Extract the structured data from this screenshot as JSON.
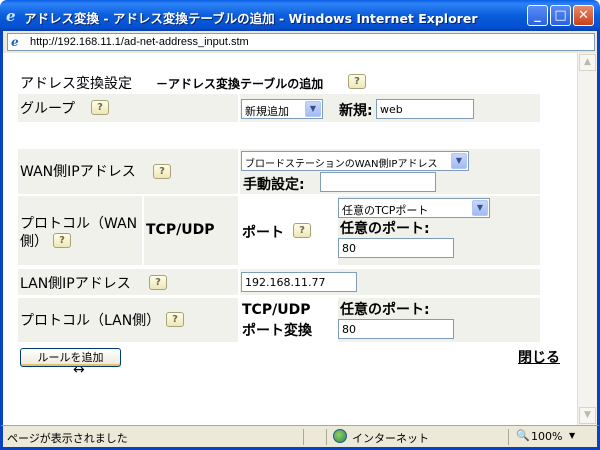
{
  "window": {
    "title": "アドレス変換 - アドレス変換テーブルの追加 - Windows Internet Explorer",
    "minimize": "_",
    "maximize": "□",
    "close": "✕"
  },
  "address_bar": {
    "url": "http://192.168.11.1/ad-net-address_input.stm"
  },
  "page": {
    "heading": "アドレス変換設定",
    "subheading": "－アドレス変換テーブルの追加",
    "group": {
      "label": "グループ",
      "select_value": "新規追加",
      "new_label": "新規:",
      "new_value": "web"
    },
    "wan": {
      "label": "WAN側IPアドレス",
      "select_value": "ブロードステーションのWAN側IPアドレス",
      "manual_label": "手動設定:",
      "manual_value": ""
    },
    "protocol_wan": {
      "label_line1": "プロトコル（WAN",
      "label_line2": "側）",
      "protocol": "TCP/UDP",
      "port_label": "ポート",
      "port_select": "任意のTCPポート",
      "any_port_label": "任意のポート:",
      "port_value": "80"
    },
    "lan": {
      "label": "LAN側IPアドレス",
      "value": "192.168.11.77"
    },
    "protocol_lan": {
      "label": "プロトコル（LAN側）",
      "conv_line1": "TCP/UDP",
      "conv_line2": "ポート変換",
      "any_port_label": "任意のポート:",
      "port_value": "80"
    },
    "add_rule_button": "ルールを追加",
    "close_link": "閉じる",
    "help_icon_glyph": "?"
  },
  "status_bar": {
    "text": "ページが表示されました",
    "zone": "インターネット",
    "zoom": "100%"
  },
  "icons": {
    "help": "help-icon",
    "ie": "ie-icon",
    "globe": "globe-icon",
    "zoom": "zoom-icon"
  },
  "colors": {
    "title_bar": "#0a5ddc",
    "frame": "#0842c0",
    "row_background": "#f1f1ec",
    "status_bar": "#ece9d8"
  }
}
